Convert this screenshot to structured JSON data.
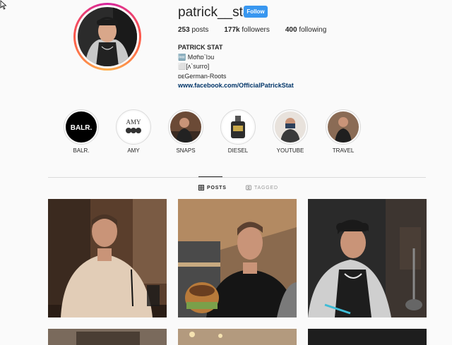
{
  "profile": {
    "username": "patrick__stat",
    "follow_label": "Follow",
    "stats": {
      "posts_value": "253",
      "posts_label": "posts",
      "followers_value": "177k",
      "followers_label": "followers",
      "following_value": "400",
      "following_label": "following"
    },
    "bio": {
      "name": "PATRICK STAT",
      "line1": "🆓 Mσɦɒ`lɔu",
      "line2": "⬜[ʌ`surro]",
      "line3": "ᴅᴇGerman-Roots",
      "link": "www.facebook.com/OfficialPatrickStat"
    }
  },
  "highlights": [
    {
      "label": "BALR."
    },
    {
      "label": "AMY",
      "logo_text": "AMY"
    },
    {
      "label": "SNAPS"
    },
    {
      "label": "DIESEL"
    },
    {
      "label": "YOUTUBE"
    },
    {
      "label": "TRAVEL"
    }
  ],
  "highlight_logo": "BALR.",
  "tabs": {
    "posts": "POSTS",
    "tagged": "TAGGED"
  },
  "icons": {
    "grid": "grid-icon",
    "tag": "tag-icon",
    "cursor": "mouse-cursor-icon"
  },
  "colors": {
    "follow_button": "#3897f0",
    "link": "#003569",
    "ring_start": "#d6249f",
    "ring_end": "#fdb04b"
  }
}
